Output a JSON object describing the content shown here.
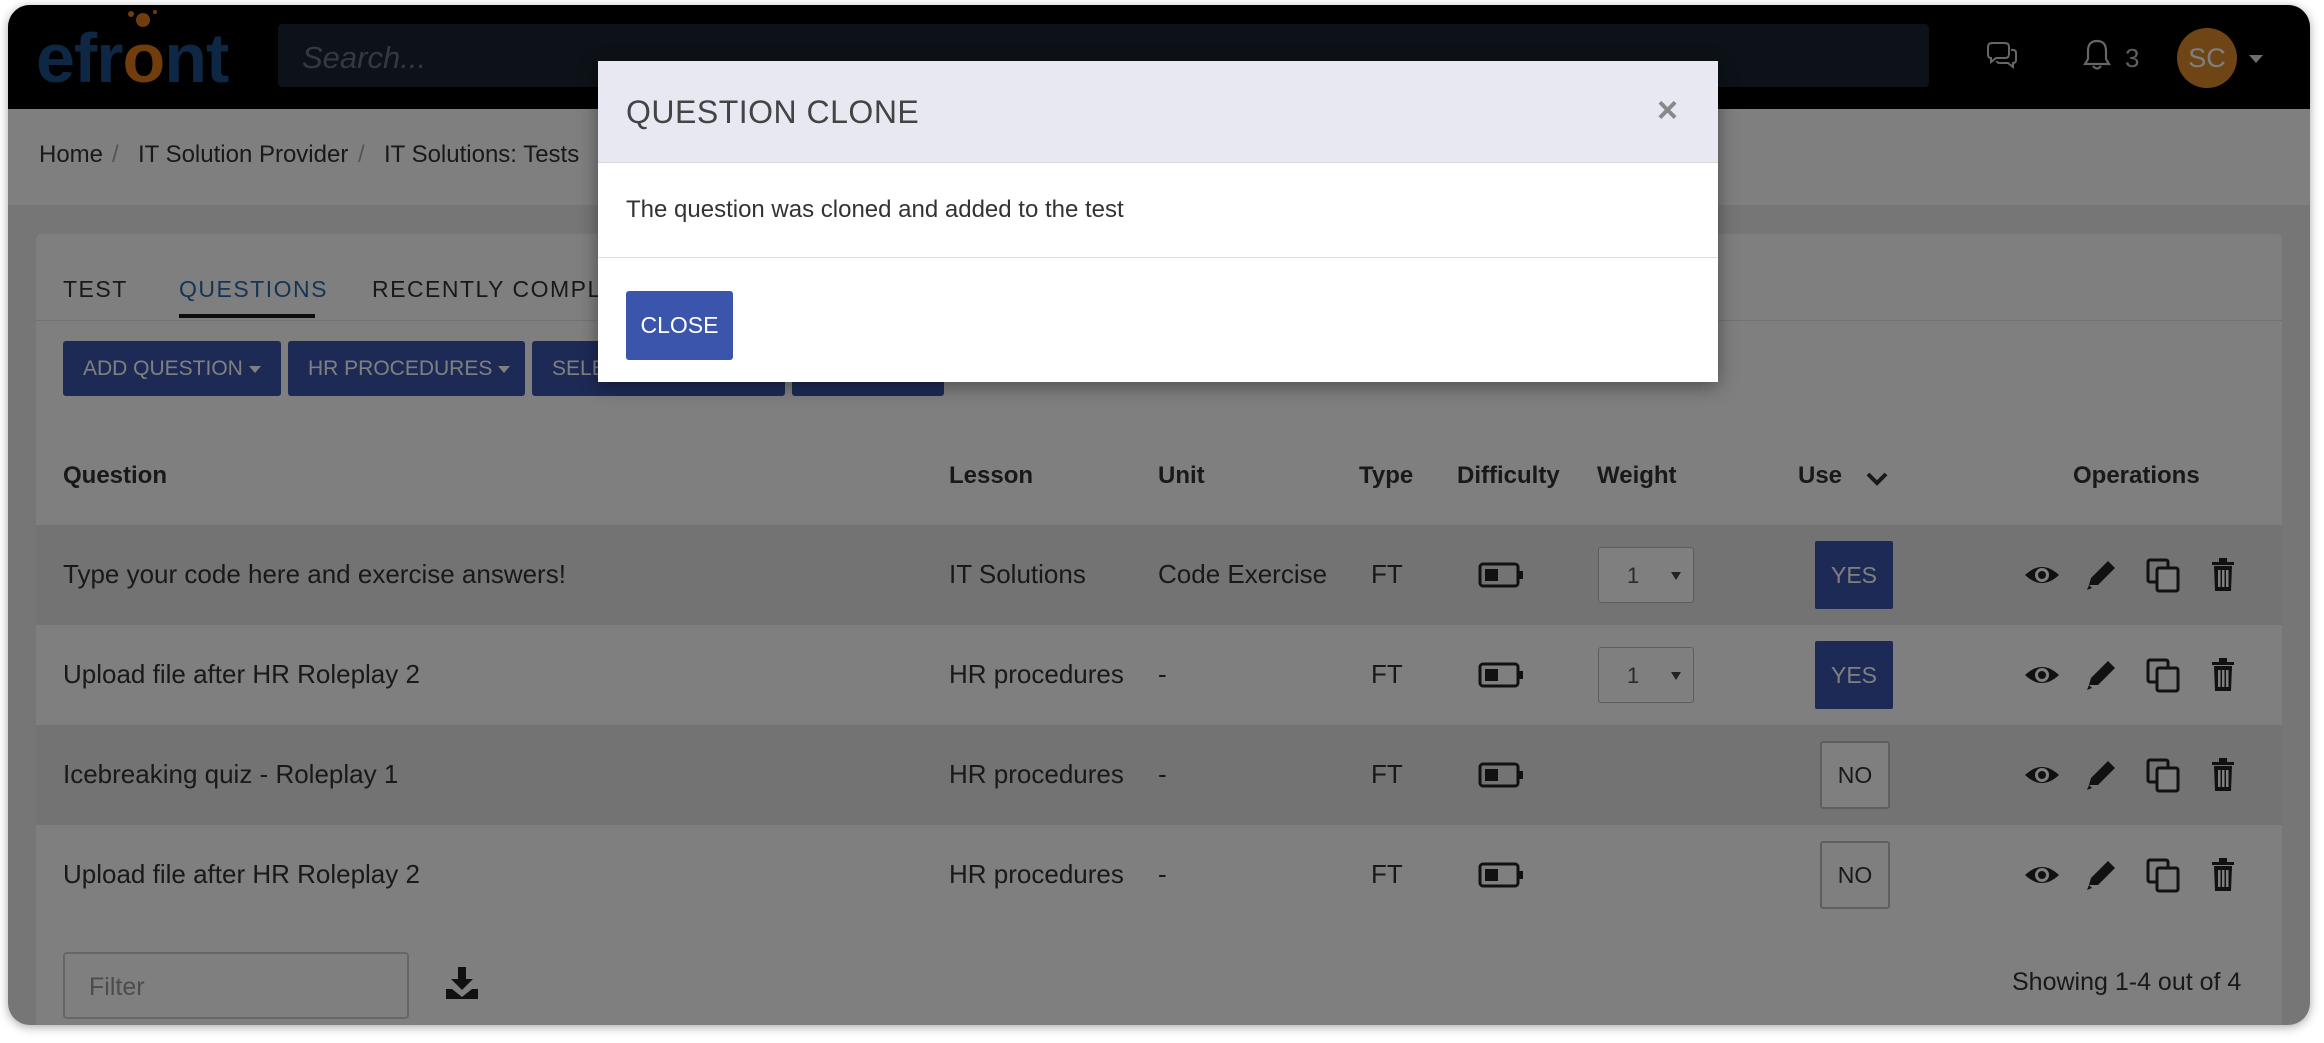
{
  "app": {
    "logo_text_1": "efr",
    "logo_text_2": "o",
    "logo_text_3": "nt",
    "search_placeholder": "Search...",
    "notifications_count": "3",
    "avatar_initials": "SC",
    "brand_color": "#3b55ad"
  },
  "breadcrumb": [
    "Home",
    "IT Solution Provider",
    "IT Solutions: Tests"
  ],
  "tabs": [
    {
      "label": "TEST",
      "active": false
    },
    {
      "label": "QUESTIONS",
      "active": true
    },
    {
      "label": "RECENTLY COMPLE",
      "active": false
    }
  ],
  "toolbar": {
    "add_question": "ADD QUESTION",
    "hr_procedures": "HR PROCEDURES",
    "select_partial": "SELE"
  },
  "table": {
    "headers": {
      "question": "Question",
      "lesson": "Lesson",
      "unit": "Unit",
      "type": "Type",
      "difficulty": "Difficulty",
      "weight": "Weight",
      "use": "Use",
      "operations": "Operations"
    },
    "rows": [
      {
        "question": "Type your code here and exercise answers!",
        "lesson": "IT Solutions",
        "unit": "Code Exercise",
        "type": "FT",
        "weight": "1",
        "use": "YES"
      },
      {
        "question": "Upload file after HR Roleplay 2",
        "lesson": "HR procedures",
        "unit": "-",
        "type": "FT",
        "weight": "1",
        "use": "YES"
      },
      {
        "question": "Icebreaking quiz - Roleplay 1",
        "lesson": "HR procedures",
        "unit": "-",
        "type": "FT",
        "weight": "",
        "use": "NO"
      },
      {
        "question": "Upload file after HR Roleplay 2",
        "lesson": "HR procedures",
        "unit": "-",
        "type": "FT",
        "weight": "",
        "use": "NO"
      }
    ]
  },
  "footer": {
    "filter_placeholder": "Filter",
    "showing": "Showing 1-4 out of 4"
  },
  "modal": {
    "title": "QUESTION CLONE",
    "close_x": "×",
    "message": "The question was cloned and added to the test",
    "close_button": "CLOSE"
  }
}
